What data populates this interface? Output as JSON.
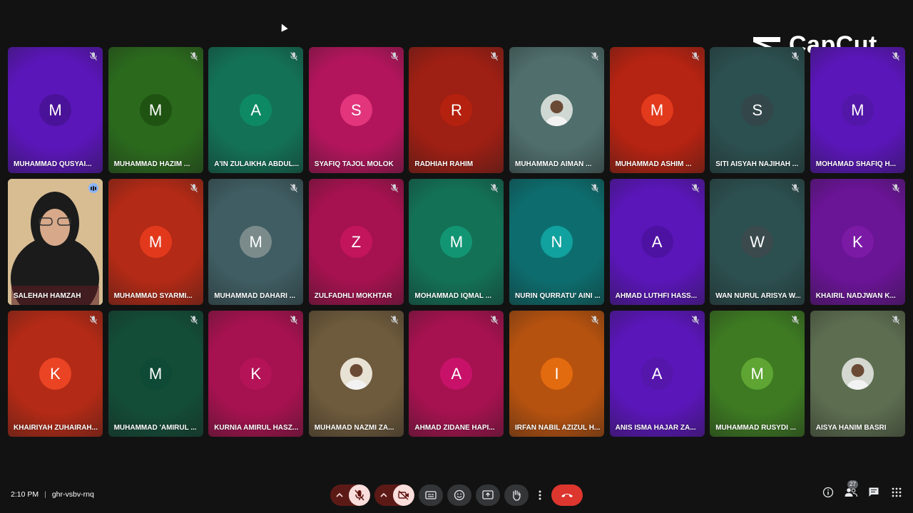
{
  "watermark": {
    "text": "CapCut",
    "icon": "capcut-logo-icon"
  },
  "participants": [
    {
      "name": "MUHAMMAD QUSYAI...",
      "initial": "M",
      "bg": "#5a16b8",
      "avatar": "#4a1299",
      "photo": false,
      "speaking": false
    },
    {
      "name": "MUHAMMAD HAZIM ...",
      "initial": "M",
      "bg": "#2b6a1d",
      "avatar": "#1f5312",
      "photo": false,
      "speaking": false
    },
    {
      "name": "A'IN ZULAIKHA ABDUL...",
      "initial": "A",
      "bg": "#137156",
      "avatar": "#0d8a64",
      "photo": false,
      "speaking": false
    },
    {
      "name": "SYAFIQ TAJOL MOLOK",
      "initial": "S",
      "bg": "#b2155c",
      "avatar": "#e2357c",
      "photo": false,
      "speaking": false
    },
    {
      "name": "RADHIAH RAHIM",
      "initial": "R",
      "bg": "#9e1f14",
      "avatar": "#b5210f",
      "photo": false,
      "speaking": false
    },
    {
      "name": "MUHAMMAD AIMAN ...",
      "initial": "",
      "bg": "#4f6e6c",
      "avatar": "#cfd8d3",
      "photo": true,
      "speaking": false
    },
    {
      "name": "MUHAMMAD ASHIM ...",
      "initial": "M",
      "bg": "#b52312",
      "avatar": "#e23a1c",
      "photo": false,
      "speaking": false
    },
    {
      "name": "SITI AISYAH NAJIHAH ...",
      "initial": "S",
      "bg": "#2c4f4f",
      "avatar": "#33474a",
      "photo": false,
      "speaking": false
    },
    {
      "name": "MOHAMAD SHAFIQ H...",
      "initial": "M",
      "bg": "#5a16b8",
      "avatar": "#5217a8",
      "photo": false,
      "speaking": false
    },
    {
      "name": "SALEHAH HAMZAH",
      "initial": "",
      "bg": "#c9a57a",
      "avatar": "",
      "photo": false,
      "speaking": true,
      "video": true
    },
    {
      "name": "MUHAMMAD SYARMI...",
      "initial": "M",
      "bg": "#b32a16",
      "avatar": "#e2391d",
      "photo": false,
      "speaking": false
    },
    {
      "name": "MUHAMMAD DAHARI ...",
      "initial": "M",
      "bg": "#3f5d62",
      "avatar": "#7b8b8c",
      "photo": false,
      "speaking": false
    },
    {
      "name": "ZULFADHLI MOKHTAR",
      "initial": "Z",
      "bg": "#a5124f",
      "avatar": "#c2155c",
      "photo": false,
      "speaking": false
    },
    {
      "name": "MOHAMMAD IQMAL ...",
      "initial": "M",
      "bg": "#137156",
      "avatar": "#129573",
      "photo": false,
      "speaking": false
    },
    {
      "name": "NURIN QURRATU' AINI ...",
      "initial": "N",
      "bg": "#0d6d6e",
      "avatar": "#11a19e",
      "photo": false,
      "speaking": false
    },
    {
      "name": "AHMAD LUTHFI HASS...",
      "initial": "A",
      "bg": "#5a16b8",
      "avatar": "#4e12a3",
      "photo": false,
      "speaking": false
    },
    {
      "name": "WAN NURUL ARISYA W...",
      "initial": "W",
      "bg": "#2c4f4f",
      "avatar": "#3a4a4d",
      "photo": false,
      "speaking": false
    },
    {
      "name": "KHAIRIL NADJWAN K...",
      "initial": "K",
      "bg": "#6a1496",
      "avatar": "#7b1aa5",
      "photo": false,
      "speaking": false
    },
    {
      "name": "KHAIRIYAH ZUHAIRAH...",
      "initial": "K",
      "bg": "#b32a16",
      "avatar": "#ea4424",
      "photo": false,
      "speaking": false
    },
    {
      "name": "MUHAMMAD 'AMIRUL ...",
      "initial": "M",
      "bg": "#134d38",
      "avatar": "#0e4a35",
      "photo": false,
      "speaking": false
    },
    {
      "name": "KURNIA AMIRUL HASZ...",
      "initial": "K",
      "bg": "#a5124f",
      "avatar": "#b41457",
      "photo": false,
      "speaking": false
    },
    {
      "name": "MUHAMAD NAZMI ZA...",
      "initial": "",
      "bg": "#6e5a3c",
      "avatar": "#e8e2d4",
      "photo": true,
      "speaking": false
    },
    {
      "name": "AHMAD ZIDANE HAPI...",
      "initial": "A",
      "bg": "#a5124f",
      "avatar": "#c8126a",
      "photo": false,
      "speaking": false
    },
    {
      "name": "IRFAN NABIL AZIZUL H...",
      "initial": "I",
      "bg": "#b6520f",
      "avatar": "#e36b0f",
      "photo": false,
      "speaking": false
    },
    {
      "name": "ANIS ISMA HAJAR ZA...",
      "initial": "A",
      "bg": "#5a16b8",
      "avatar": "#5516ac",
      "photo": false,
      "speaking": false
    },
    {
      "name": "MUHAMMAD RUSYDI ...",
      "initial": "M",
      "bg": "#3d7a22",
      "avatar": "#5ea533",
      "photo": false,
      "speaking": false
    },
    {
      "name": "AISYA HANIM BASRI",
      "initial": "",
      "bg": "#5d6e50",
      "avatar": "#d4d8d0",
      "photo": true,
      "speaking": false
    }
  ],
  "bottom": {
    "time": "2:10 PM",
    "separator": "|",
    "meeting_code": "ghr-vsbv-rnq",
    "participant_count": "27"
  },
  "colors": {
    "muted_accent": "#f9dedc",
    "end_call": "#dc362e",
    "button_bg": "#333537"
  }
}
